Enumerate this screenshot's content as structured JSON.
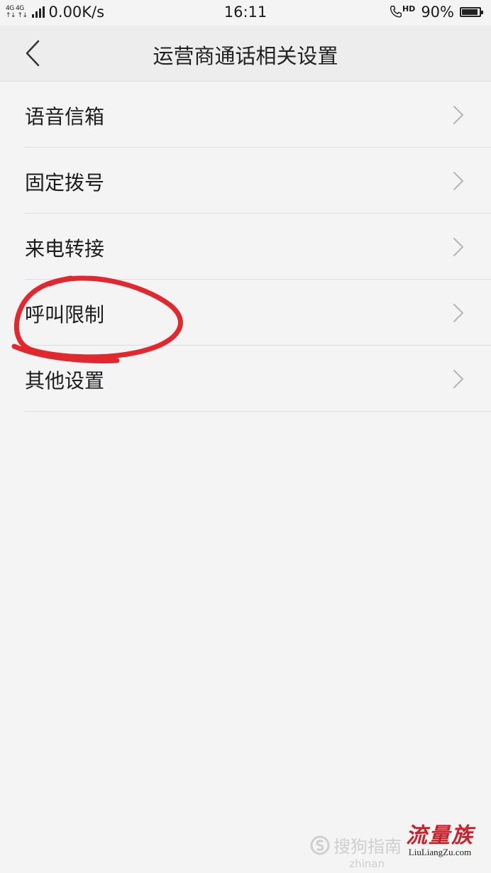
{
  "status_bar": {
    "network_top": "4G 4G",
    "network_bottom": "↑↓ ↑↓",
    "speed": "0.00K/s",
    "time": "16:11",
    "hd_label": "HD",
    "battery_percent": "90%",
    "battery_level": 0.9
  },
  "header": {
    "title": "运营商通话相关设置"
  },
  "menu": {
    "items": [
      {
        "label": "语音信箱"
      },
      {
        "label": "固定拨号"
      },
      {
        "label": "来电转接"
      },
      {
        "label": "呼叫限制"
      },
      {
        "label": "其他设置"
      }
    ]
  },
  "watermark": {
    "guide_text": "搜狗指南",
    "guide_sub": "zhinan",
    "brand_text": "流量族",
    "brand_url": "LiuLiangZu.com"
  },
  "colors": {
    "annotation": "#e0282e",
    "brand": "#c9222a"
  }
}
